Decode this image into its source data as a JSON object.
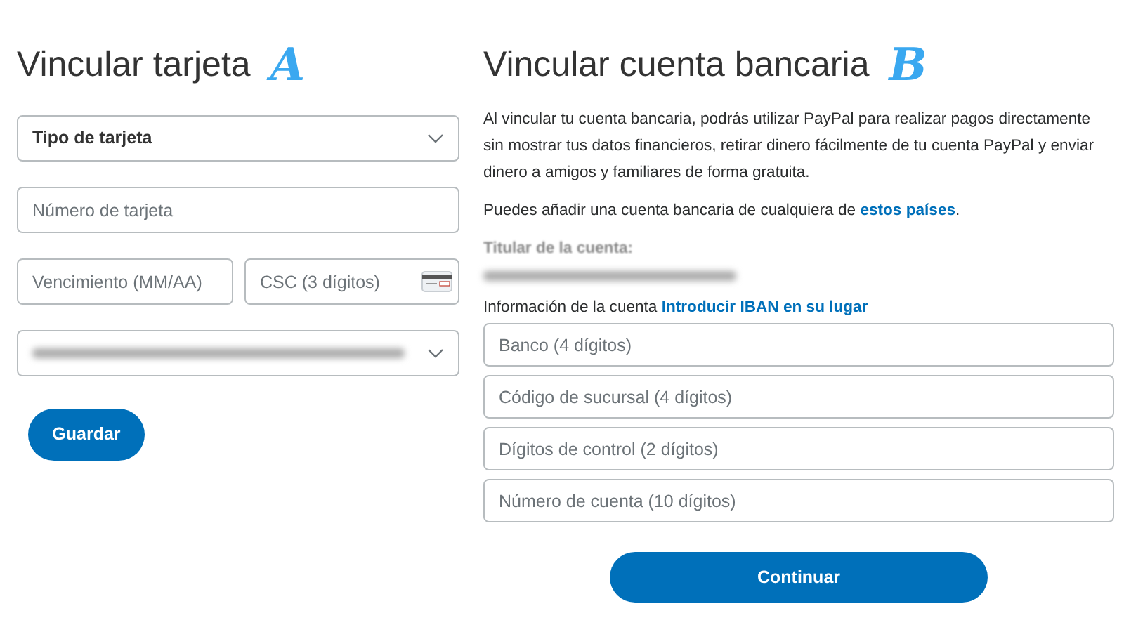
{
  "card_form": {
    "title": "Vincular tarjeta",
    "marker": "A",
    "card_type": {
      "value": "Tipo de tarjeta"
    },
    "card_number": {
      "placeholder": "Número de tarjeta"
    },
    "expiry": {
      "placeholder": "Vencimiento (MM/AA)"
    },
    "csc": {
      "placeholder": "CSC (3 dígitos)"
    },
    "save_button": "Guardar"
  },
  "bank_form": {
    "title": "Vincular cuenta bancaria",
    "marker": "B",
    "intro": "Al vincular tu cuenta bancaria, podrás utilizar PayPal para realizar pagos directamente sin mostrar tus datos financieros, retirar dinero fácilmente de tu cuenta PayPal y enviar dinero a amigos y familiares de forma gratuita.",
    "countries_note": {
      "text": "Puedes añadir una cuenta bancaria de cualquiera de ",
      "link": "estos países",
      "after": "."
    },
    "holder_label": "Titular de la cuenta:",
    "account_info": {
      "label": "Información de la cuenta",
      "link": "Introducir IBAN en su lugar"
    },
    "fields": [
      {
        "placeholder": "Banco (4 dígitos)"
      },
      {
        "placeholder": "Código de sucursal (4 dígitos)"
      },
      {
        "placeholder": "Dígitos de control (2 dígitos)"
      },
      {
        "placeholder": "Número de cuenta (10 dígitos)"
      }
    ],
    "continue_button": "Continuar"
  }
}
